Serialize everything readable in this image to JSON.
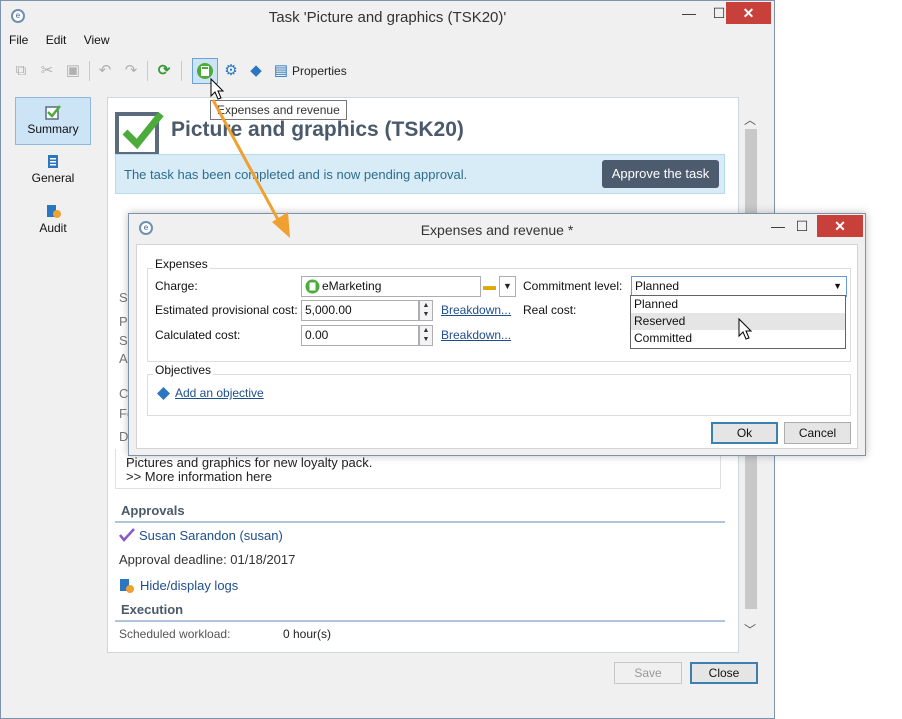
{
  "window": {
    "title": "Task 'Picture and graphics (TSK20)'",
    "min": "—",
    "max": "☐",
    "close": "✕"
  },
  "menu": [
    "File",
    "Edit",
    "View"
  ],
  "toolbar": {
    "properties_label": "Properties",
    "tooltip": "Expenses and revenue"
  },
  "nav": [
    {
      "label": "Summary",
      "icon": "checkbox-icon"
    },
    {
      "label": "General",
      "icon": "clipboard-icon"
    },
    {
      "label": "Audit",
      "icon": "audit-icon"
    }
  ],
  "task": {
    "title": "Picture and graphics (TSK20)",
    "banner_text": "The task has been completed and is now pending approval.",
    "approve_label": "Approve the task",
    "partial_labels": [
      "St",
      "Pr",
      "Sc",
      "As",
      "C",
      "Fe",
      "D"
    ],
    "description_lines": [
      "Pictures and graphics for new loyalty pack.",
      ">> More information here"
    ]
  },
  "approvals": {
    "heading": "Approvals",
    "approver": "Susan Sarandon (susan)",
    "deadline": "Approval deadline: 01/18/2017",
    "logs_link": "Hide/display logs"
  },
  "execution": {
    "heading": "Execution",
    "workload_label": "Scheduled workload:",
    "workload_value": "0 hour(s)"
  },
  "footer": {
    "save_label": "Save",
    "close_label": "Close"
  },
  "dialog": {
    "title": "Expenses and revenue *",
    "expenses_group": "Expenses",
    "charge_label": "Charge:",
    "charge_value": "eMarketing",
    "commitment_label": "Commitment level:",
    "commitment_value": "Planned",
    "commitment_options": [
      "Planned",
      "Reserved",
      "Committed"
    ],
    "estimated_label": "Estimated provisional cost:",
    "estimated_value": "5,000.00",
    "breakdown_label": "Breakdown...",
    "real_cost_label": "Real cost:",
    "calculated_label": "Calculated cost:",
    "calculated_value": "0.00",
    "objectives_group": "Objectives",
    "add_objective": "Add an objective",
    "ok_label": "Ok",
    "cancel_label": "Cancel"
  },
  "colors": {
    "accent_orange": "#f0a030",
    "check_green": "#4cab3a",
    "link_blue": "#1f4e8c",
    "banner_bg": "#d7ecf7",
    "approve_bg": "#4d5b6f"
  }
}
